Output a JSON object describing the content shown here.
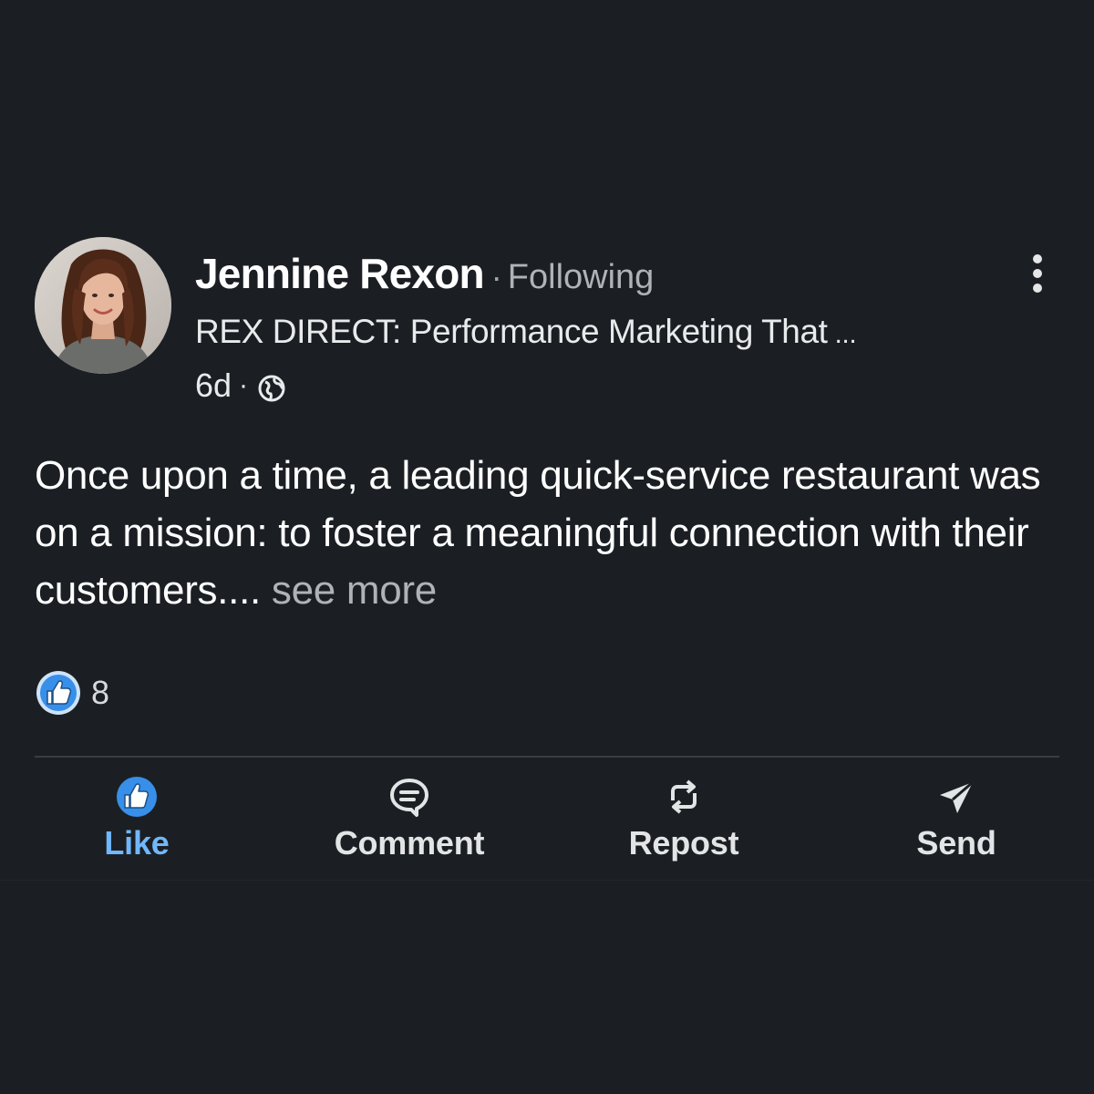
{
  "post": {
    "author": {
      "name": "Jennine Rexon",
      "separator": "·",
      "follow_status": "Following",
      "headline": "REX DIRECT: Performance Marketing That",
      "headline_ellipsis": " ...",
      "time": "6d",
      "time_separator": "·",
      "visibility_icon": "globe-icon"
    },
    "text": "Once upon a time, a leading quick-service restaurant was on a mission: to foster a meaningful connection with their customers.... ",
    "see_more": "see more",
    "reactions": {
      "icon": "like-reaction-icon",
      "count": "8"
    },
    "actions": [
      {
        "label": "Like",
        "icon": "thumbs-up-icon",
        "color": "#71b7fb"
      },
      {
        "label": "Comment",
        "icon": "comment-icon",
        "color": "#e3e4e5"
      },
      {
        "label": "Repost",
        "icon": "repost-icon",
        "color": "#e3e4e5"
      },
      {
        "label": "Send",
        "icon": "send-icon",
        "color": "#e3e4e5"
      }
    ]
  },
  "colors": {
    "background": "#1b1f23",
    "accent": "#71b7fb",
    "like_badge": "#378fe9",
    "muted_text": "#b0b3b6"
  }
}
